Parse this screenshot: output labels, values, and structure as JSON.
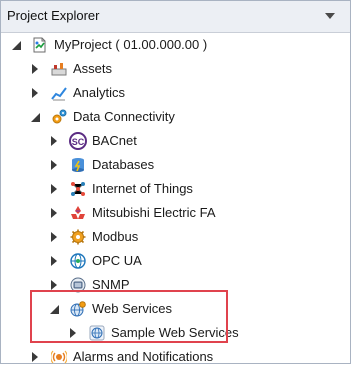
{
  "panel": {
    "title": "Project Explorer",
    "dropdown_icon": "chevron-down-icon"
  },
  "tree": {
    "root": {
      "label": "MyProject ( 01.00.000.00 )",
      "icon": "project-icon",
      "expanded": true
    },
    "assets": {
      "label": "Assets",
      "icon": "assets-icon"
    },
    "analytics": {
      "label": "Analytics",
      "icon": "analytics-icon"
    },
    "data_connectivity": {
      "label": "Data Connectivity",
      "icon": "gears-icon",
      "expanded": true,
      "children": {
        "bacnet": {
          "label": "BACnet",
          "icon": "bacnet-icon"
        },
        "databases": {
          "label": "Databases",
          "icon": "databases-icon"
        },
        "iot": {
          "label": "Internet of Things",
          "icon": "iot-icon"
        },
        "mitsubishi": {
          "label": "Mitsubishi Electric FA",
          "icon": "mitsubishi-icon"
        },
        "modbus": {
          "label": "Modbus",
          "icon": "modbus-icon"
        },
        "opcua": {
          "label": "OPC UA",
          "icon": "opcua-icon"
        },
        "snmp": {
          "label": "SNMP",
          "icon": "snmp-icon"
        },
        "web_services": {
          "label": "Web Services",
          "icon": "web-services-icon",
          "expanded": true,
          "children": {
            "sample": {
              "label": "Sample Web Services",
              "icon": "web-service-item-icon"
            }
          }
        }
      }
    },
    "alarms": {
      "label": "Alarms and Notifications",
      "icon": "alarm-icon"
    }
  },
  "colors": {
    "highlight_border": "#e0434d",
    "titlebar_bg": "#eceff4"
  }
}
